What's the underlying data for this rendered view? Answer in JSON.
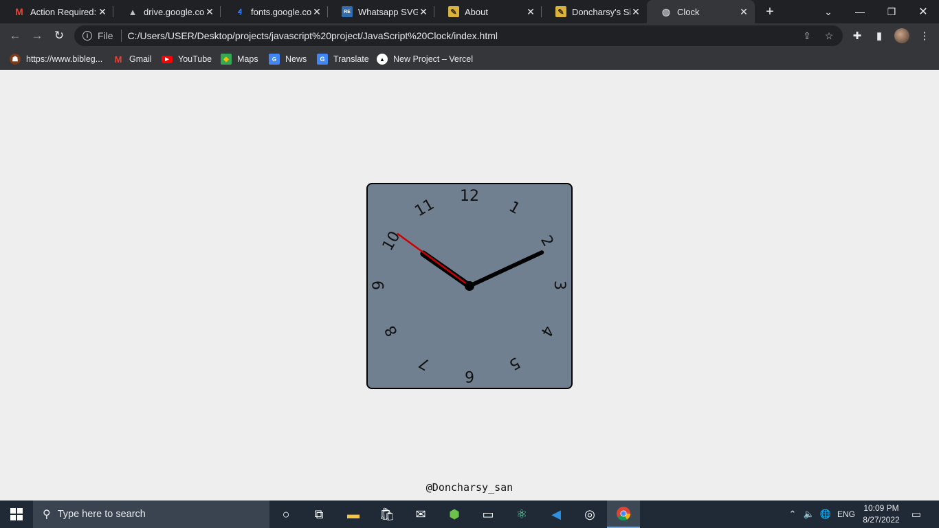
{
  "browser": {
    "tabs": [
      {
        "title": "Action Required:",
        "favicon": "gmail-icon"
      },
      {
        "title": "drive.google.com",
        "favicon": "drive-icon"
      },
      {
        "title": "fonts.google.com",
        "favicon": "fonts-icon"
      },
      {
        "title": "Whatsapp SVG V",
        "favicon": "repo-icon"
      },
      {
        "title": "About",
        "favicon": "site-icon"
      },
      {
        "title": "Doncharsy's Site",
        "favicon": "site-icon"
      },
      {
        "title": "Clock",
        "favicon": "globe-icon"
      }
    ],
    "active_tab": "Clock",
    "address": {
      "scheme_label": "File",
      "url": "C:/Users/USER/Desktop/projects/javascript%20project/JavaScript%20Clock/index.html"
    },
    "bookmarks": [
      {
        "label": "https://www.bibleg...",
        "icon": "biblegateway-icon"
      },
      {
        "label": "Gmail",
        "icon": "gmail-icon"
      },
      {
        "label": "YouTube",
        "icon": "youtube-icon"
      },
      {
        "label": "Maps",
        "icon": "maps-icon"
      },
      {
        "label": "News",
        "icon": "news-icon"
      },
      {
        "label": "Translate",
        "icon": "translate-icon"
      },
      {
        "label": "New Project – Vercel",
        "icon": "vercel-icon"
      }
    ]
  },
  "clock": {
    "numbers": [
      "12",
      "1",
      "2",
      "3",
      "4",
      "5",
      "6",
      "7",
      "8",
      "9",
      "10",
      "11"
    ],
    "time_shown": {
      "hour": 10,
      "minute": 10,
      "second": 51
    },
    "face_color": "#708090",
    "hand_color": "#000000",
    "second_hand_color": "#cc0000"
  },
  "credit": "@Doncharsy_san",
  "taskbar": {
    "search_placeholder": "Type here to search",
    "language": "ENG",
    "time": "10:09 PM",
    "date": "8/27/2022"
  }
}
